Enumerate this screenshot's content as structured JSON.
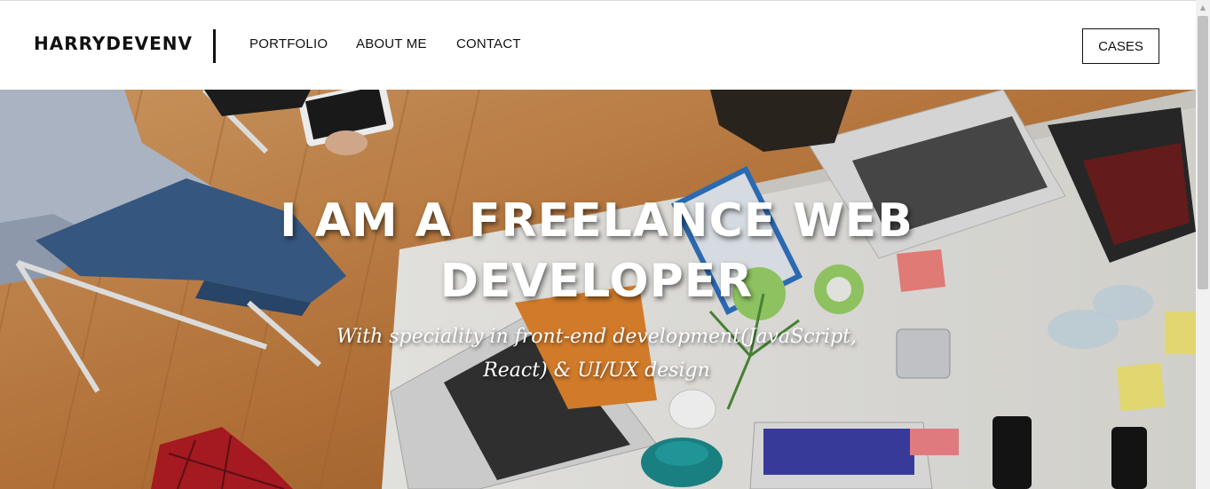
{
  "header": {
    "brand": "HARRYDEVENV",
    "nav": {
      "portfolio": "PORTFOLIO",
      "about": "ABOUT ME",
      "contact": "CONTACT"
    },
    "cases_label": "CASES"
  },
  "hero": {
    "title_line1": "I AM A FREELANCE WEB",
    "title_line2": "DEVELOPER",
    "subtitle_line1": "With speciality in front-end development(JavaScript,",
    "subtitle_line2": "React) & UI/UX design"
  },
  "colors": {
    "text": "#111111",
    "header_bg": "#ffffff",
    "hero_text": "#ffffff",
    "wood_floor": "#c88a4b",
    "desk": "#ecebe6"
  },
  "icons": {
    "scroll_up": "scroll-up-arrow-icon"
  }
}
